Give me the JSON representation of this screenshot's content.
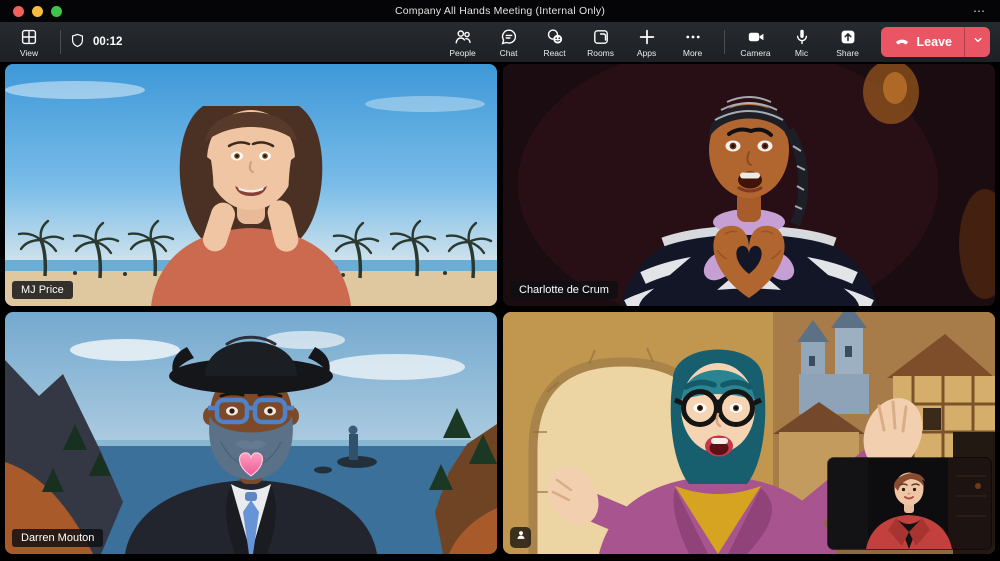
{
  "window": {
    "title": "Company All Hands Meeting (Internal Only)",
    "titlebar_more": "⋯"
  },
  "toolbar": {
    "view_label": "View",
    "timer": "00:12",
    "buttons": [
      {
        "label": "People",
        "icon": "people-icon"
      },
      {
        "label": "Chat",
        "icon": "chat-icon"
      },
      {
        "label": "React",
        "icon": "react-icon"
      },
      {
        "label": "Rooms",
        "icon": "rooms-icon"
      },
      {
        "label": "Apps",
        "icon": "apps-plus-icon"
      },
      {
        "label": "More",
        "icon": "more-ellipsis-icon"
      },
      {
        "label": "Camera",
        "icon": "camera-icon"
      },
      {
        "label": "Mic",
        "icon": "mic-icon"
      },
      {
        "label": "Share",
        "icon": "share-icon"
      }
    ],
    "leave_label": "Leave"
  },
  "participants": [
    {
      "name": "MJ Price"
    },
    {
      "name": "Charlotte de Crum"
    },
    {
      "name": "Darren Mouton"
    },
    {
      "name": "",
      "badge_icon": "avatar-badge-icon"
    }
  ],
  "colors": {
    "leave_button": "#ea5564",
    "toolbar_bg": "#202428",
    "titlebar_bg": "#050507",
    "name_label_bg": "rgba(15,15,17,0.82)",
    "glasses_blue": "#4f82c8"
  }
}
